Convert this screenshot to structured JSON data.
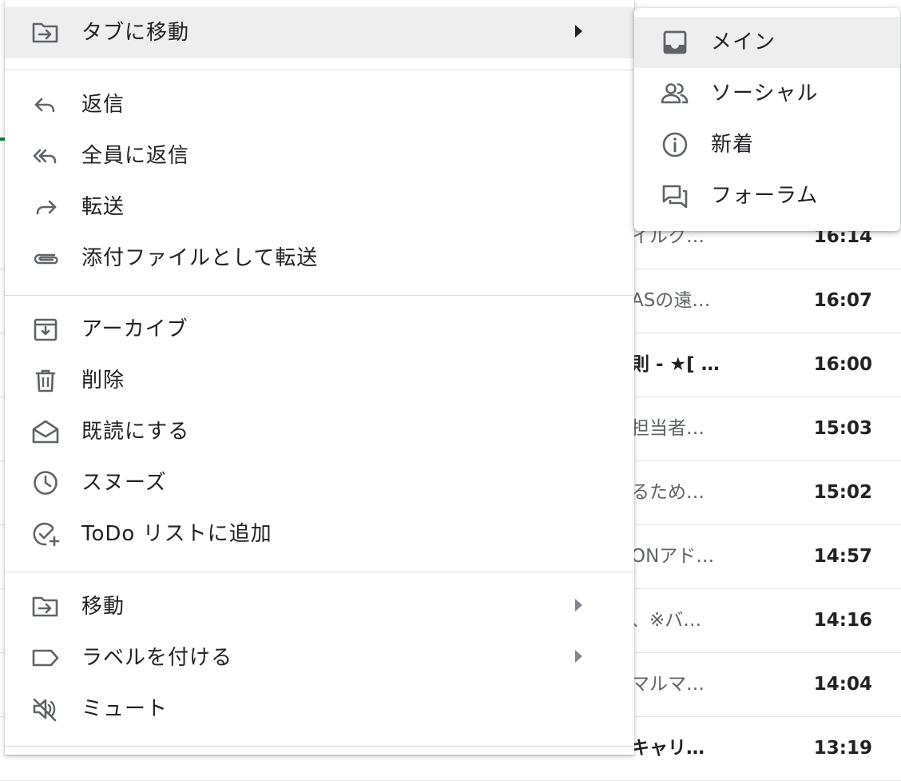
{
  "context_menu": {
    "items": [
      {
        "label": "タブに移動",
        "icon": "move-to-tab-icon",
        "has_submenu": true
      },
      {
        "label": "返信",
        "icon": "reply-icon"
      },
      {
        "label": "全員に返信",
        "icon": "reply-all-icon"
      },
      {
        "label": "転送",
        "icon": "forward-icon"
      },
      {
        "label": "添付ファイルとして転送",
        "icon": "attachment-icon"
      },
      {
        "label": "アーカイブ",
        "icon": "archive-icon"
      },
      {
        "label": "削除",
        "icon": "trash-icon"
      },
      {
        "label": "既読にする",
        "icon": "mark-read-icon"
      },
      {
        "label": "スヌーズ",
        "icon": "clock-icon"
      },
      {
        "label": "ToDo リストに追加",
        "icon": "add-task-icon"
      },
      {
        "label": "移動",
        "icon": "move-folder-icon",
        "has_submenu": true
      },
      {
        "label": "ラベルを付ける",
        "icon": "label-icon",
        "has_submenu": true
      },
      {
        "label": "ミュート",
        "icon": "mute-icon"
      }
    ]
  },
  "tab_submenu": {
    "items": [
      {
        "label": "メイン",
        "icon": "inbox-icon"
      },
      {
        "label": "ソーシャル",
        "icon": "people-icon"
      },
      {
        "label": "新着",
        "icon": "info-icon"
      },
      {
        "label": "フォーラム",
        "icon": "forum-icon"
      }
    ]
  },
  "inbox_rows": [
    {
      "snippet": "イルク…",
      "time": "16:14"
    },
    {
      "snippet": "ASの遠…",
      "time": "16:07"
    },
    {
      "snippet": "則 - ★[ …",
      "time": "16:00"
    },
    {
      "snippet": "担当者…",
      "time": "15:03"
    },
    {
      "snippet": "るため…",
      "time": "15:02"
    },
    {
      "snippet": "ONアド…",
      "time": "14:57"
    },
    {
      "snippet": "、※バ…",
      "time": "14:16"
    },
    {
      "snippet": "マルマ…",
      "time": "14:04"
    },
    {
      "snippet": "キャリ…",
      "time": "13:19"
    }
  ],
  "colors": {
    "highlight": "#eeeeee",
    "icon": "#5f6368",
    "text": "#202124",
    "divider": "#dadce0"
  }
}
